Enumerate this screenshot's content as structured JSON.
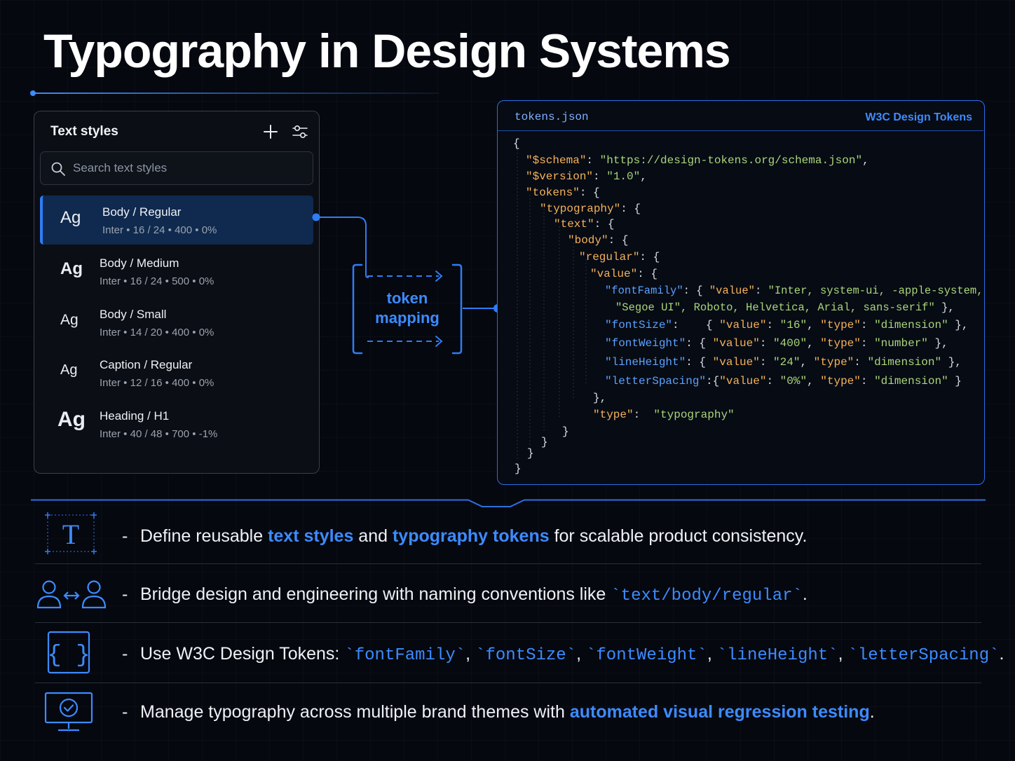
{
  "title": "Typography in Design Systems",
  "panel": {
    "title": "Text styles",
    "add_icon": "plus-icon",
    "settings_icon": "sliders-icon",
    "search_placeholder": "Search text styles",
    "styles": [
      {
        "sample": "Ag",
        "name": "Body / Regular",
        "font": "Inter",
        "size": "16 / 24",
        "weight": "400",
        "tracking": "0%",
        "selected": true
      },
      {
        "sample": "Ag",
        "name": "Body / Medium",
        "font": "Inter",
        "size": "16 / 24",
        "weight": "500",
        "tracking": "0%",
        "selected": false
      },
      {
        "sample": "Ag",
        "name": "Body / Small",
        "font": "Inter",
        "size": "14 / 20",
        "weight": "400",
        "tracking": "0%",
        "selected": false
      },
      {
        "sample": "Ag",
        "name": "Caption / Regular",
        "font": "Inter",
        "size": "12 / 16",
        "weight": "400",
        "tracking": "0%",
        "selected": false
      },
      {
        "sample": "Ag",
        "name": "Heading / H1",
        "font": "Inter",
        "size": "40 / 48",
        "weight": "700",
        "tracking": "-1%",
        "selected": false
      }
    ]
  },
  "mapping": {
    "line1": "token",
    "line2": "mapping"
  },
  "code": {
    "file": "tokens.json",
    "badge": "W3C Design Tokens",
    "schema_key": "\"$schema\"",
    "schema_val": "\"https://design-tokens.org/schema.json\"",
    "version_key": "\"$version\"",
    "version_val": "\"1.0\"",
    "tokens_key": "\"tokens\"",
    "typography_key": "\"typography\"",
    "text_key": "\"text\"",
    "body_key": "\"body\"",
    "regular_key": "\"regular\"",
    "value_key": "\"value\"",
    "props": [
      {
        "key": "\"fontFamily\"",
        "value": "\"Inter, system-ui, -apple-system,",
        "value2": "\"Segoe UI\", Roboto, Helvetica, Arial, sans-serif\"",
        "type": ""
      },
      {
        "key": "\"fontSize\"",
        "value": "\"16\"",
        "type": "\"dimension\""
      },
      {
        "key": "\"fontWeight\"",
        "value": "\"400\"",
        "type": "\"number\""
      },
      {
        "key": "\"lineHeight\"",
        "value": "\"24\"",
        "type": "\"dimension\""
      },
      {
        "key": "\"letterSpacing\"",
        "value": "\"0%\"",
        "type": "\"dimension\""
      }
    ],
    "q_value": "\"value\"",
    "q_type": "\"type\"",
    "type_key": "\"type\"",
    "type_val": "\"typography\""
  },
  "bullets": [
    {
      "icon": "text-style-icon",
      "dash": "-",
      "parts": [
        "Define reusable ",
        "text styles",
        " and ",
        "typography tokens",
        " for scalable product consistency."
      ]
    },
    {
      "icon": "designer-developer-icon",
      "dash": "-",
      "parts": [
        "Bridge design and engineering with naming conventions like ",
        "`text/body/regular`",
        "."
      ]
    },
    {
      "icon": "braces-icon",
      "dash": "-",
      "parts": [
        "Use W3C Design Tokens: ",
        "`fontFamily`",
        ", ",
        "`fontSize`",
        ", ",
        "`fontWeight`",
        ", ",
        "`lineHeight`",
        ", ",
        "`letterSpacing`",
        "."
      ]
    },
    {
      "icon": "monitor-check-icon",
      "dash": "-",
      "parts": [
        "Manage typography across multiple brand themes with ",
        "automated visual regression testing",
        "."
      ]
    }
  ],
  "colors": {
    "accent": "#3d8bff",
    "key": "#f5b25a",
    "string": "#a8d67a",
    "background": "#05080f"
  }
}
